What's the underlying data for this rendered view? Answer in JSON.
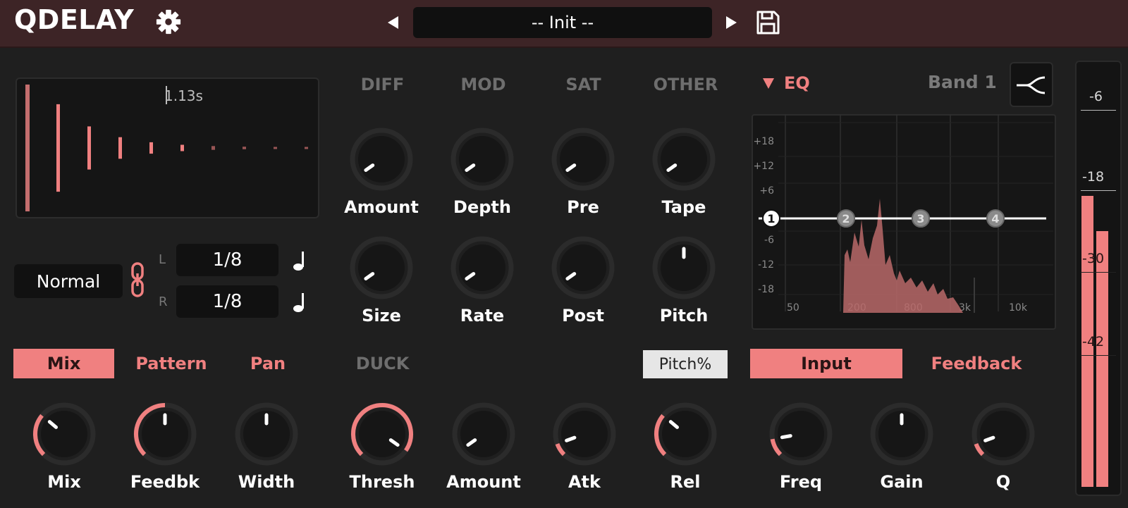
{
  "header": {
    "title": "QDELAY",
    "preset_name": "-- Init --"
  },
  "delay": {
    "time_readout": "1.13s",
    "mode": "Normal",
    "left_label": "L",
    "right_label": "R",
    "left_time": "1/8",
    "right_time": "1/8",
    "tap_levels": [
      1.0,
      0.69,
      0.34,
      0.17,
      0.09,
      0.05,
      0.03,
      0.02,
      0.01,
      0.005
    ]
  },
  "fx": {
    "tabs": [
      "DIFF",
      "MOD",
      "SAT",
      "OTHER"
    ],
    "knobs_row1": [
      "Amount",
      "Depth",
      "Pre",
      "Tape"
    ],
    "knobs_row2": [
      "Size",
      "Rate",
      "Post",
      "Pitch"
    ]
  },
  "eq": {
    "title": "EQ",
    "band_label": "Band 1",
    "db_labels": [
      "+18",
      "+12",
      "+6",
      "-6",
      "-12",
      "-18"
    ],
    "freq_labels": [
      "50",
      "200",
      "800",
      "3k",
      "10k"
    ],
    "band_numbers": [
      "1",
      "2",
      "3",
      "4"
    ]
  },
  "bottom": {
    "tabs_left": [
      "Mix",
      "Pattern",
      "Pan"
    ],
    "duck_tab": "DUCK",
    "pitch_badge": "Pitch%",
    "eq_tabs": [
      "Input",
      "Feedback"
    ],
    "knobs": [
      "Mix",
      "Feedbk",
      "Width",
      "Thresh",
      "Amount",
      "Atk",
      "Rel",
      "Freq",
      "Gain",
      "Q"
    ]
  },
  "meter": {
    "scale": [
      "-6",
      "-18",
      "-30",
      "-42"
    ]
  },
  "colors": {
    "accent": "#f08080",
    "background": "#1f1f1f",
    "header": "#3d2426"
  },
  "icons": {
    "settings": "gear-icon",
    "prev": "triangle-left-icon",
    "next": "triangle-right-icon",
    "save": "floppy-disk-icon",
    "link": "chain-link-icon",
    "note": "quarter-note-icon",
    "filter": "filter-shape-icon"
  }
}
